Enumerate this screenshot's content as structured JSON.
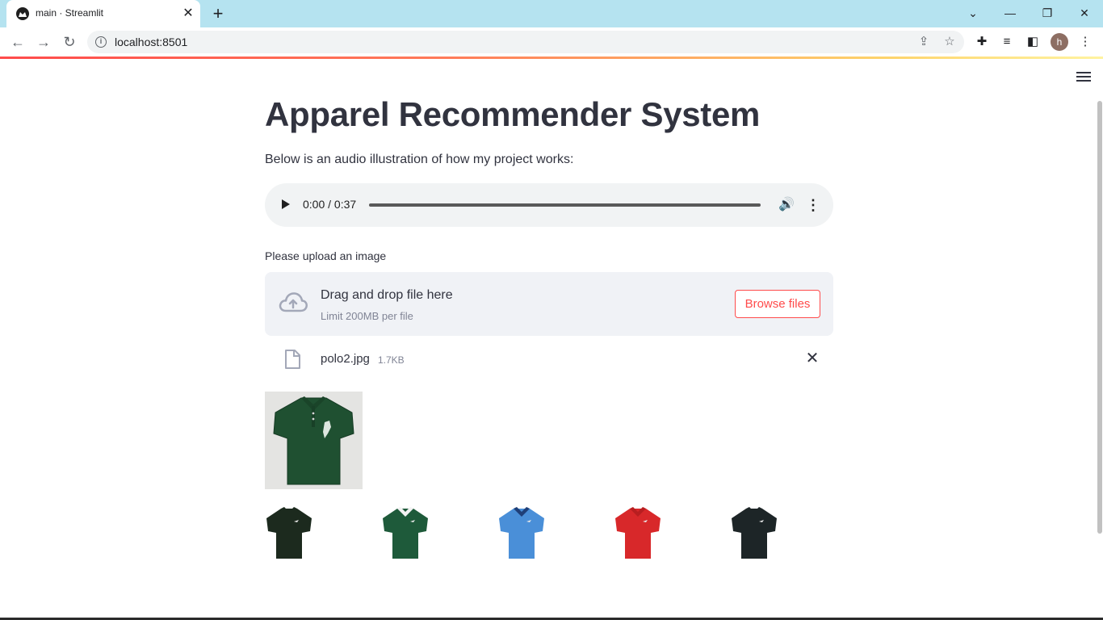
{
  "browser": {
    "tab_title": "main · Streamlit",
    "url": "localhost:8501",
    "profile_initial": "h"
  },
  "app": {
    "title": "Apparel Recommender System",
    "intro": "Below is an audio illustration of how my project works:",
    "audio": {
      "time_display": "0:00 / 0:37",
      "progress": 0
    },
    "uploader": {
      "label": "Please upload an image",
      "drop_text": "Drag and drop file here",
      "limit_text": "Limit 200MB per file",
      "browse_label": "Browse files"
    },
    "uploaded_file": {
      "name": "polo2.jpg",
      "size": "1.7KB"
    },
    "recommendations": [
      {
        "name": "recommendation-1",
        "color": "#1c2a1e",
        "collar": "#1c2a1e"
      },
      {
        "name": "recommendation-2",
        "color": "#1e5a3a",
        "collar": "#f2f2f2"
      },
      {
        "name": "recommendation-3",
        "color": "#4a8fd8",
        "collar": "#1f3f78"
      },
      {
        "name": "recommendation-4",
        "color": "#d8282a",
        "collar": "#b81e20"
      },
      {
        "name": "recommendation-5",
        "color": "#1d2527",
        "collar": "#1d2527"
      }
    ]
  },
  "colors": {
    "accent": "#ff4b4b",
    "text": "#31333f",
    "uploaded_shirt": "#1f5031"
  }
}
